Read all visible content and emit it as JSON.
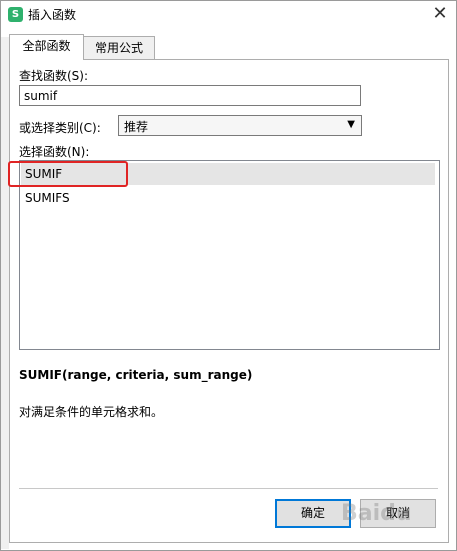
{
  "window": {
    "title": "插入函数",
    "app_icon_letter": "S",
    "close_glyph": "✕"
  },
  "tabs": [
    {
      "label": "全部函数",
      "active": true
    },
    {
      "label": "常用公式",
      "active": false
    }
  ],
  "search": {
    "label": "查找函数(S):",
    "value": "sumif"
  },
  "category": {
    "label": "或选择类别(C):",
    "selected": "推荐",
    "arrow_glyph": "▼"
  },
  "function_list": {
    "label": "选择函数(N):",
    "items": [
      "SUMIF",
      "SUMIFS"
    ],
    "selected_index": 0,
    "highlight_color": "#e02424"
  },
  "details": {
    "signature": "SUMIF(range, criteria, sum_range)",
    "description": "对满足条件的单元格求和。"
  },
  "buttons": {
    "ok": "确定",
    "cancel": "取消"
  },
  "watermark": "Baidu"
}
